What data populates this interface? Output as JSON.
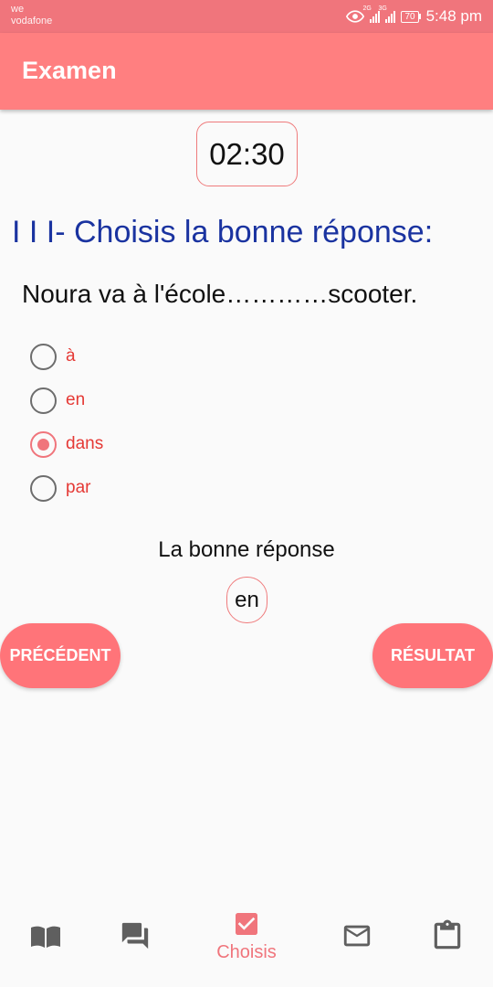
{
  "status_bar": {
    "carrier_line1": "we",
    "carrier_line2": "vodafone",
    "network1": "2G",
    "network2": "3G",
    "battery": "70",
    "time": "5:48 pm"
  },
  "app_bar": {
    "title": "Examen"
  },
  "timer": {
    "value": "02:30"
  },
  "section_title": "I I I- Choisis la bonne réponse:",
  "question": "Noura va à l'école…………scooter.",
  "options": [
    {
      "label": "à",
      "selected": false
    },
    {
      "label": "en",
      "selected": false
    },
    {
      "label": "dans",
      "selected": true
    },
    {
      "label": "par",
      "selected": false
    }
  ],
  "answer": {
    "label": "La bonne réponse",
    "value": "en"
  },
  "buttons": {
    "previous": "PRÉCÉDENT",
    "result": "RÉSULTAT"
  },
  "bottom_nav": {
    "items": [
      {
        "icon": "book-icon",
        "label": ""
      },
      {
        "icon": "forum-icon",
        "label": ""
      },
      {
        "icon": "check-box-icon",
        "label": "Choisis",
        "active": true
      },
      {
        "icon": "mail-icon",
        "label": ""
      },
      {
        "icon": "clipboard-icon",
        "label": ""
      }
    ]
  },
  "colors": {
    "status_bar": "#f0757c",
    "app_bar": "#ff7f80",
    "accent": "#f0757c",
    "title_blue": "#1a33a0",
    "option_text": "#e53935",
    "nav_icon": "#5f5f5f"
  }
}
